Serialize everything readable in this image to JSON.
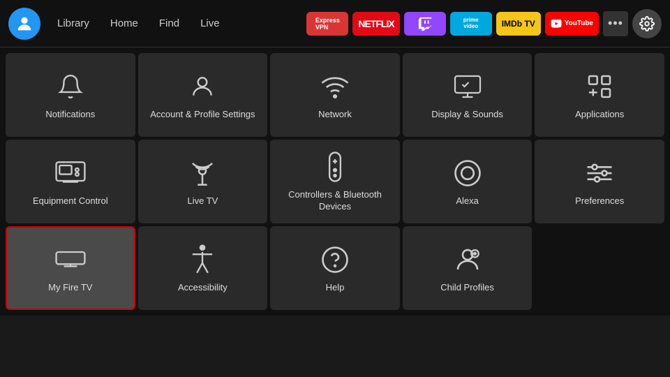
{
  "nav": {
    "links": [
      "Library",
      "Home",
      "Find",
      "Live"
    ],
    "apps": [
      {
        "label": "ExpressVPN",
        "class": "badge-expressvpn"
      },
      {
        "label": "NETFLIX",
        "class": "badge-netflix"
      },
      {
        "label": "≈",
        "class": "badge-twitch"
      },
      {
        "label": "prime video",
        "class": "badge-prime"
      },
      {
        "label": "IMDb TV",
        "class": "badge-imdb"
      },
      {
        "label": "▶ YouTube",
        "class": "badge-youtube"
      }
    ],
    "more_label": "•••",
    "settings_label": "⚙"
  },
  "grid": {
    "items": [
      {
        "id": "notifications",
        "label": "Notifications",
        "icon": "bell"
      },
      {
        "id": "account-profile",
        "label": "Account & Profile Settings",
        "icon": "person"
      },
      {
        "id": "network",
        "label": "Network",
        "icon": "wifi"
      },
      {
        "id": "display-sounds",
        "label": "Display & Sounds",
        "icon": "display"
      },
      {
        "id": "applications",
        "label": "Applications",
        "icon": "apps"
      },
      {
        "id": "equipment-control",
        "label": "Equipment Control",
        "icon": "tv"
      },
      {
        "id": "live-tv",
        "label": "Live TV",
        "icon": "antenna"
      },
      {
        "id": "controllers-bluetooth",
        "label": "Controllers & Bluetooth Devices",
        "icon": "remote"
      },
      {
        "id": "alexa",
        "label": "Alexa",
        "icon": "alexa"
      },
      {
        "id": "preferences",
        "label": "Preferences",
        "icon": "sliders"
      },
      {
        "id": "my-fire-tv",
        "label": "My Fire TV",
        "icon": "firetv",
        "selected": true
      },
      {
        "id": "accessibility",
        "label": "Accessibility",
        "icon": "accessibility"
      },
      {
        "id": "help",
        "label": "Help",
        "icon": "help"
      },
      {
        "id": "child-profiles",
        "label": "Child Profiles",
        "icon": "child-profile"
      }
    ]
  }
}
